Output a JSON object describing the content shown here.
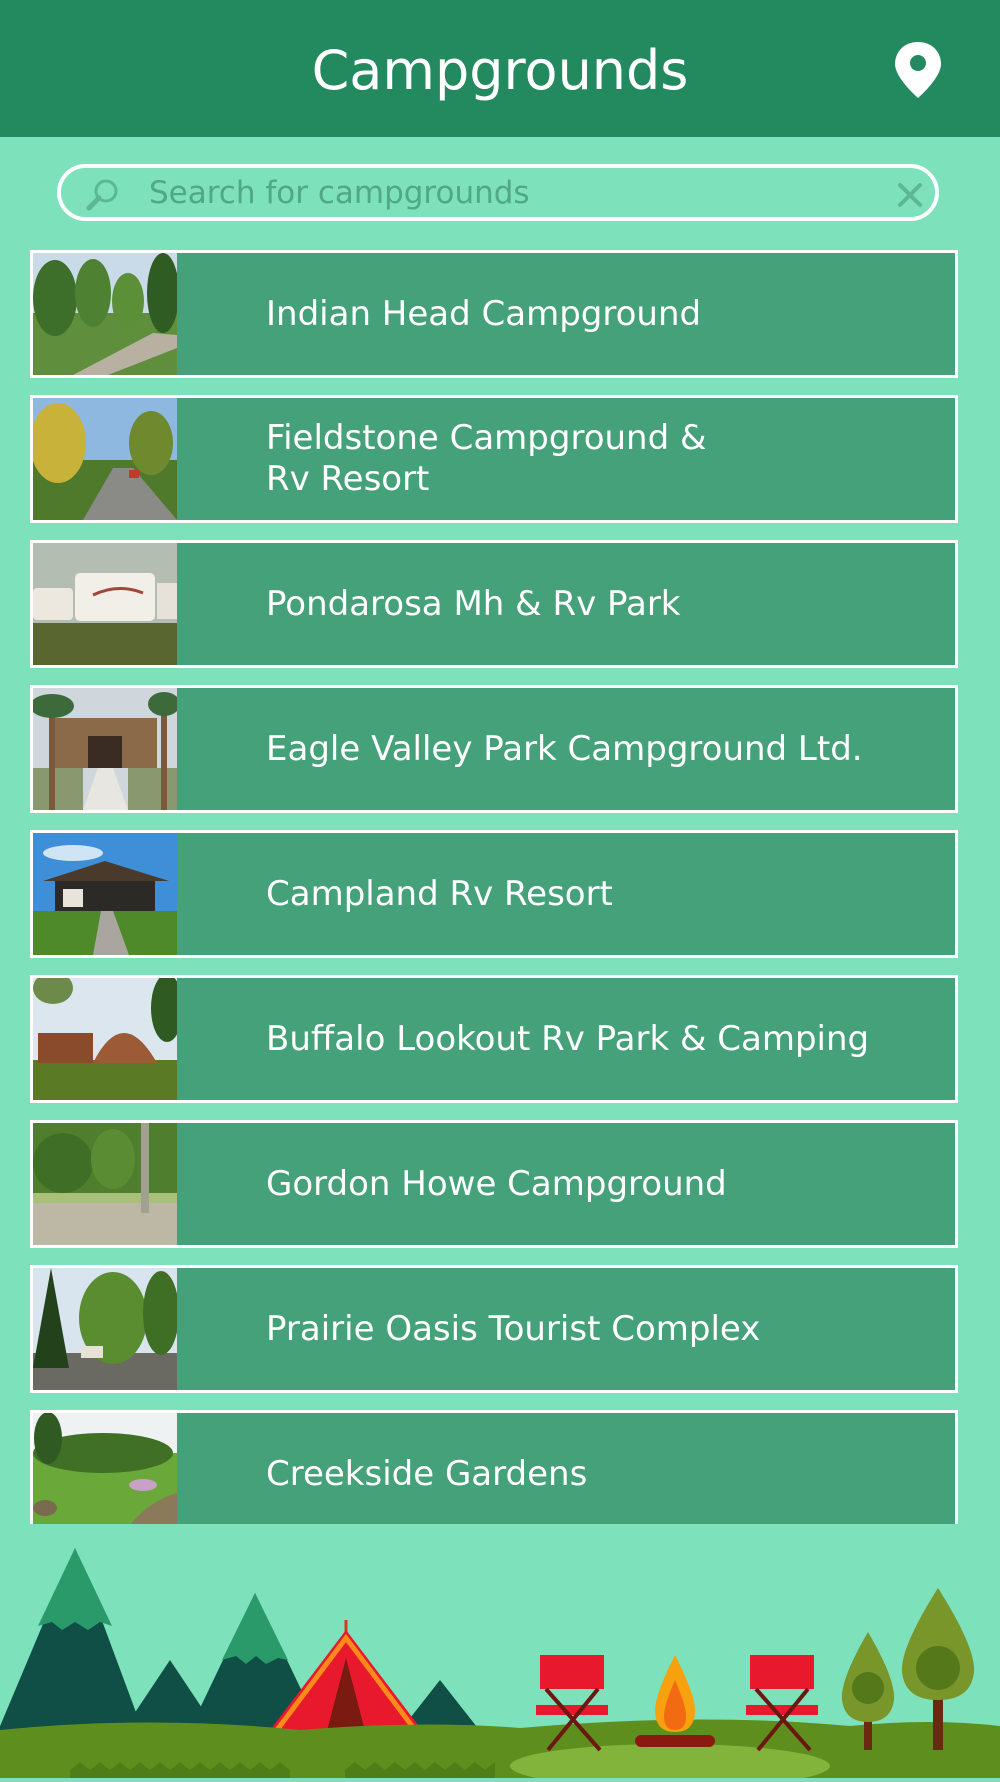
{
  "header": {
    "title": "Campgrounds",
    "location_icon": "map-pin-icon"
  },
  "search": {
    "placeholder": "Search for campgrounds",
    "value": "",
    "search_icon": "magnifier-icon",
    "clear_icon": "close-icon"
  },
  "campgrounds": [
    {
      "name": "Indian Head Campground",
      "thumbnail": "tree-lined gravel road"
    },
    {
      "name": "Fieldstone Campground &\nRv Resort",
      "thumbnail": "paved road with autumn trees"
    },
    {
      "name": "Pondarosa Mh & Rv Park",
      "thumbnail": "parked RV trailers"
    },
    {
      "name": "Eagle Valley Park Campground Ltd.",
      "thumbnail": "building with palm trees"
    },
    {
      "name": "Campland Rv Resort",
      "thumbnail": "pavilion under blue sky"
    },
    {
      "name": "Buffalo Lookout Rv Park & Camping",
      "thumbnail": "log buildings on lawn"
    },
    {
      "name": "Gordon Howe Campground",
      "thumbnail": "green hedges and trees"
    },
    {
      "name": "Prairie Oasis Tourist Complex",
      "thumbnail": "RV among trees"
    },
    {
      "name": "Creekside Gardens",
      "thumbnail": "garden path and lawn"
    }
  ],
  "colors": {
    "header": "#238a60",
    "background": "#7de1bb",
    "row": "#45a17a",
    "row_border": "#ffffff",
    "text": "#ffffff"
  },
  "footer": {
    "illustration": "camping scene: mountains, red tent, campfire, two folding chairs, trees"
  }
}
